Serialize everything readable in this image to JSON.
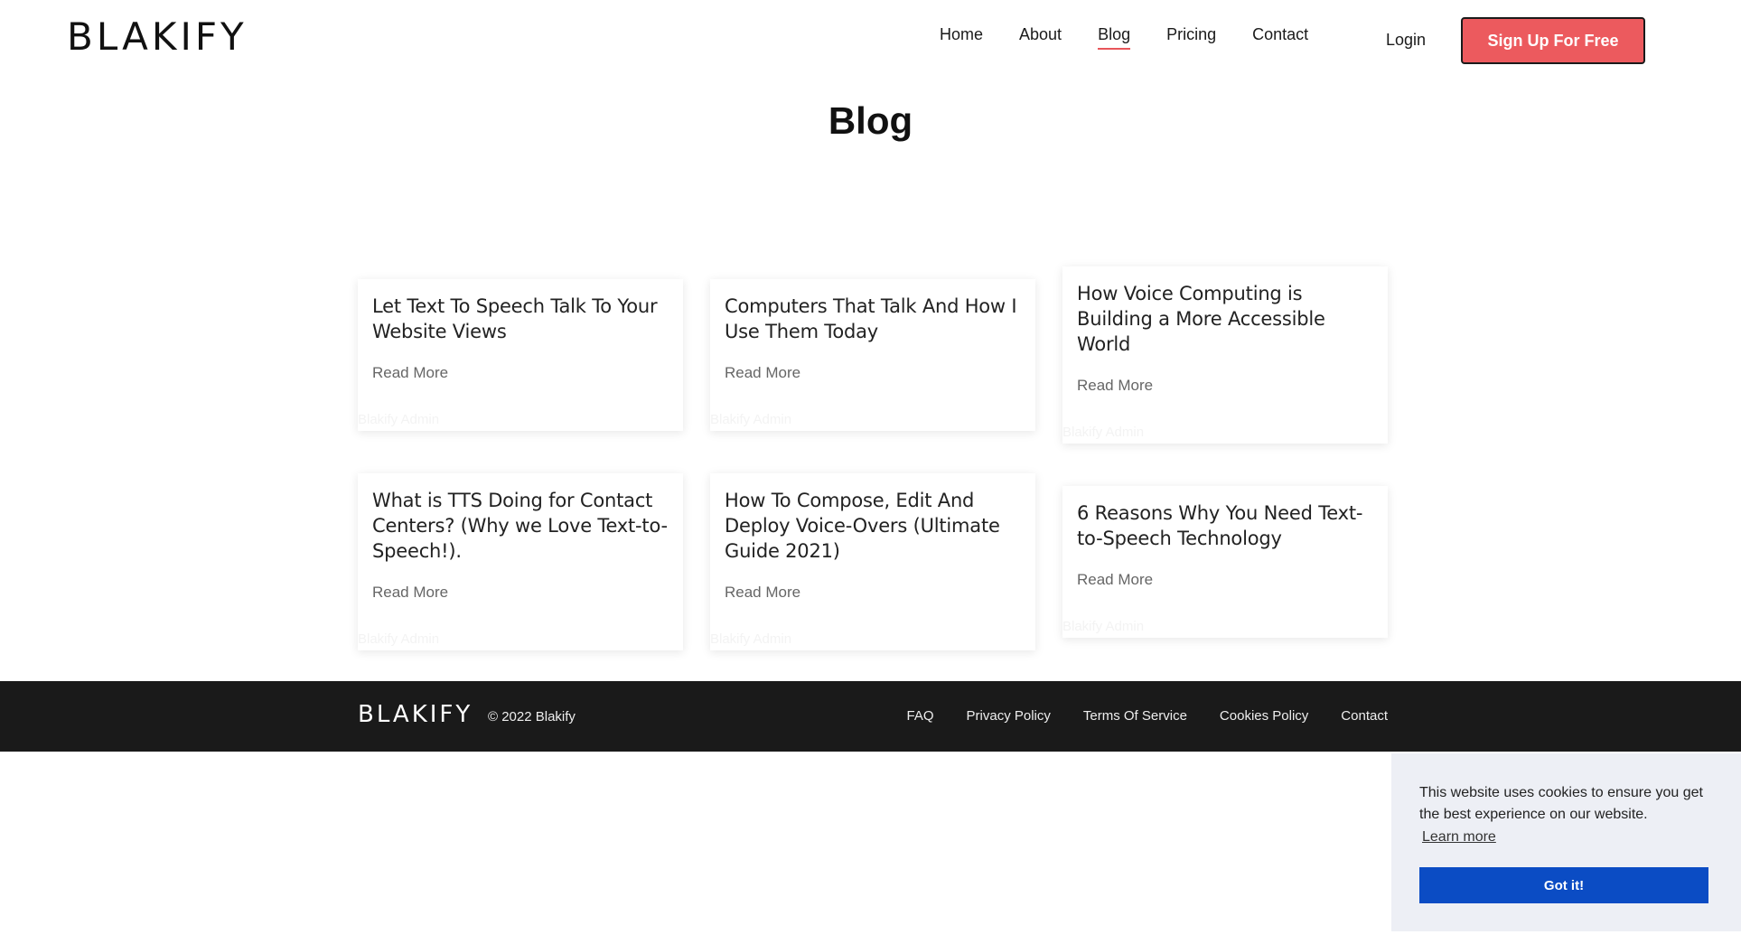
{
  "header": {
    "logo": "BLAKIFY",
    "nav": [
      {
        "label": "Home"
      },
      {
        "label": "About"
      },
      {
        "label": "Blog",
        "active": true
      },
      {
        "label": "Pricing"
      },
      {
        "label": "Contact"
      }
    ],
    "login": "Login",
    "signup": "Sign Up For Free"
  },
  "page": {
    "title": "Blog"
  },
  "posts": [
    {
      "title": "Let Text To Speech Talk To Your Website Views",
      "read_more": "Read More",
      "author": "Blakify Admin"
    },
    {
      "title": "Computers That Talk And How I Use Them Today",
      "read_more": "Read More",
      "author": "Blakify Admin"
    },
    {
      "title": "How Voice Computing is Building a More Accessible World",
      "read_more": "Read More",
      "author": "Blakify Admin"
    },
    {
      "title": "What is TTS Doing for Contact Centers? (Why we Love Text-to-Speech!).",
      "read_more": "Read More",
      "author": "Blakify Admin"
    },
    {
      "title": "How To Compose, Edit And Deploy Voice-Overs (Ultimate Guide 2021)",
      "read_more": "Read More",
      "author": "Blakify Admin"
    },
    {
      "title": "6 Reasons Why You Need Text-to-Speech Technology",
      "read_more": "Read More",
      "author": "Blakify Admin"
    }
  ],
  "footer": {
    "logo": "BLAKIFY",
    "copyright": "© 2022 Blakify",
    "links": [
      "FAQ",
      "Privacy Policy",
      "Terms Of Service",
      "Cookies Policy",
      "Contact"
    ]
  },
  "cookie": {
    "message": "This website uses cookies to ensure you get the best experience on our website.",
    "learn_more": "Learn more",
    "button": "Got it!"
  },
  "colors": {
    "accent": "#ec5a5e",
    "footer_bg": "#1a1a1a",
    "cookie_button": "#0b4cc4",
    "cookie_bg": "#edeff5"
  }
}
